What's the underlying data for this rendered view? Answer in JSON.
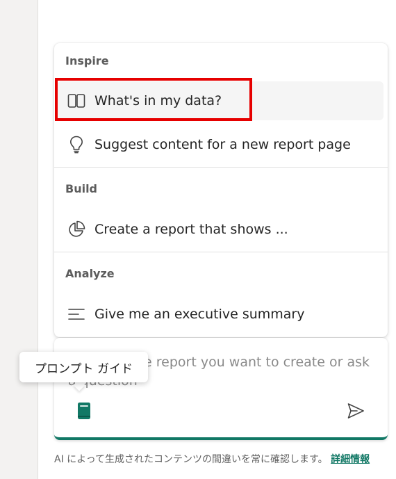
{
  "menu": {
    "sections": [
      {
        "header": "Inspire",
        "items": [
          {
            "label": "What's in my data?",
            "icon": "book-open-icon"
          },
          {
            "label": "Suggest content for a new report page",
            "icon": "lightbulb-icon"
          }
        ]
      },
      {
        "header": "Build",
        "items": [
          {
            "label": "Create a report that shows ...",
            "icon": "pie-chart-icon"
          }
        ]
      },
      {
        "header": "Analyze",
        "items": [
          {
            "label": "Give me an executive summary",
            "icon": "text-lines-icon"
          }
        ]
      }
    ]
  },
  "input": {
    "placeholder": "Describe the report you want to create or ask a question"
  },
  "tooltip": {
    "text": "プロンプト ガイド"
  },
  "disclaimer": {
    "text": "AI によって生成されたコンテンツの間違いを常に確認します。",
    "link": "詳細情報"
  },
  "colors": {
    "accent": "#117865",
    "highlight": "#e60000"
  }
}
